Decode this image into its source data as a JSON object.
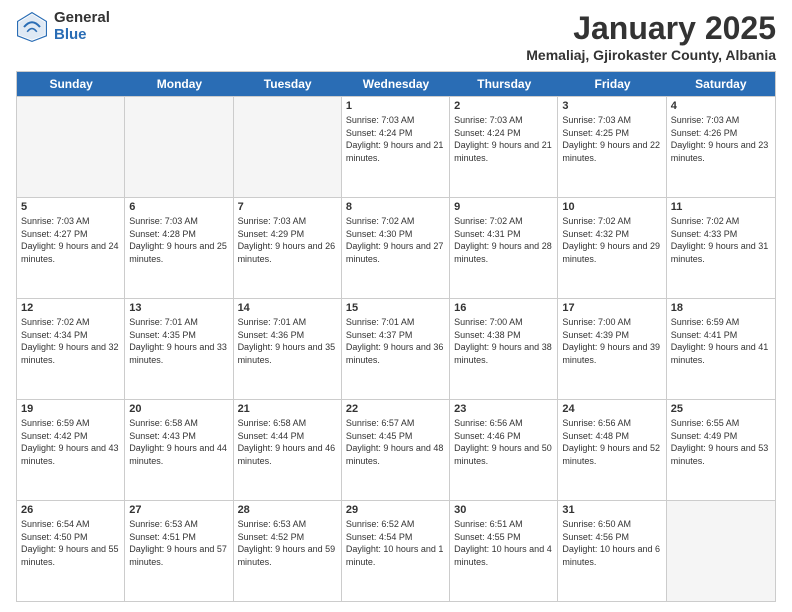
{
  "logo": {
    "general": "General",
    "blue": "Blue"
  },
  "header": {
    "month": "January 2025",
    "location": "Memaliaj, Gjirokaster County, Albania"
  },
  "weekdays": [
    "Sunday",
    "Monday",
    "Tuesday",
    "Wednesday",
    "Thursday",
    "Friday",
    "Saturday"
  ],
  "weeks": [
    [
      {
        "day": "",
        "empty": true
      },
      {
        "day": "",
        "empty": true
      },
      {
        "day": "",
        "empty": true
      },
      {
        "day": "1",
        "sunrise": "7:03 AM",
        "sunset": "4:24 PM",
        "daylight": "9 hours and 21 minutes."
      },
      {
        "day": "2",
        "sunrise": "7:03 AM",
        "sunset": "4:24 PM",
        "daylight": "9 hours and 21 minutes."
      },
      {
        "day": "3",
        "sunrise": "7:03 AM",
        "sunset": "4:25 PM",
        "daylight": "9 hours and 22 minutes."
      },
      {
        "day": "4",
        "sunrise": "7:03 AM",
        "sunset": "4:26 PM",
        "daylight": "9 hours and 23 minutes."
      }
    ],
    [
      {
        "day": "5",
        "sunrise": "7:03 AM",
        "sunset": "4:27 PM",
        "daylight": "9 hours and 24 minutes."
      },
      {
        "day": "6",
        "sunrise": "7:03 AM",
        "sunset": "4:28 PM",
        "daylight": "9 hours and 25 minutes."
      },
      {
        "day": "7",
        "sunrise": "7:03 AM",
        "sunset": "4:29 PM",
        "daylight": "9 hours and 26 minutes."
      },
      {
        "day": "8",
        "sunrise": "7:02 AM",
        "sunset": "4:30 PM",
        "daylight": "9 hours and 27 minutes."
      },
      {
        "day": "9",
        "sunrise": "7:02 AM",
        "sunset": "4:31 PM",
        "daylight": "9 hours and 28 minutes."
      },
      {
        "day": "10",
        "sunrise": "7:02 AM",
        "sunset": "4:32 PM",
        "daylight": "9 hours and 29 minutes."
      },
      {
        "day": "11",
        "sunrise": "7:02 AM",
        "sunset": "4:33 PM",
        "daylight": "9 hours and 31 minutes."
      }
    ],
    [
      {
        "day": "12",
        "sunrise": "7:02 AM",
        "sunset": "4:34 PM",
        "daylight": "9 hours and 32 minutes."
      },
      {
        "day": "13",
        "sunrise": "7:01 AM",
        "sunset": "4:35 PM",
        "daylight": "9 hours and 33 minutes."
      },
      {
        "day": "14",
        "sunrise": "7:01 AM",
        "sunset": "4:36 PM",
        "daylight": "9 hours and 35 minutes."
      },
      {
        "day": "15",
        "sunrise": "7:01 AM",
        "sunset": "4:37 PM",
        "daylight": "9 hours and 36 minutes."
      },
      {
        "day": "16",
        "sunrise": "7:00 AM",
        "sunset": "4:38 PM",
        "daylight": "9 hours and 38 minutes."
      },
      {
        "day": "17",
        "sunrise": "7:00 AM",
        "sunset": "4:39 PM",
        "daylight": "9 hours and 39 minutes."
      },
      {
        "day": "18",
        "sunrise": "6:59 AM",
        "sunset": "4:41 PM",
        "daylight": "9 hours and 41 minutes."
      }
    ],
    [
      {
        "day": "19",
        "sunrise": "6:59 AM",
        "sunset": "4:42 PM",
        "daylight": "9 hours and 43 minutes."
      },
      {
        "day": "20",
        "sunrise": "6:58 AM",
        "sunset": "4:43 PM",
        "daylight": "9 hours and 44 minutes."
      },
      {
        "day": "21",
        "sunrise": "6:58 AM",
        "sunset": "4:44 PM",
        "daylight": "9 hours and 46 minutes."
      },
      {
        "day": "22",
        "sunrise": "6:57 AM",
        "sunset": "4:45 PM",
        "daylight": "9 hours and 48 minutes."
      },
      {
        "day": "23",
        "sunrise": "6:56 AM",
        "sunset": "4:46 PM",
        "daylight": "9 hours and 50 minutes."
      },
      {
        "day": "24",
        "sunrise": "6:56 AM",
        "sunset": "4:48 PM",
        "daylight": "9 hours and 52 minutes."
      },
      {
        "day": "25",
        "sunrise": "6:55 AM",
        "sunset": "4:49 PM",
        "daylight": "9 hours and 53 minutes."
      }
    ],
    [
      {
        "day": "26",
        "sunrise": "6:54 AM",
        "sunset": "4:50 PM",
        "daylight": "9 hours and 55 minutes."
      },
      {
        "day": "27",
        "sunrise": "6:53 AM",
        "sunset": "4:51 PM",
        "daylight": "9 hours and 57 minutes."
      },
      {
        "day": "28",
        "sunrise": "6:53 AM",
        "sunset": "4:52 PM",
        "daylight": "9 hours and 59 minutes."
      },
      {
        "day": "29",
        "sunrise": "6:52 AM",
        "sunset": "4:54 PM",
        "daylight": "10 hours and 1 minute."
      },
      {
        "day": "30",
        "sunrise": "6:51 AM",
        "sunset": "4:55 PM",
        "daylight": "10 hours and 4 minutes."
      },
      {
        "day": "31",
        "sunrise": "6:50 AM",
        "sunset": "4:56 PM",
        "daylight": "10 hours and 6 minutes."
      },
      {
        "day": "",
        "empty": true
      }
    ]
  ]
}
